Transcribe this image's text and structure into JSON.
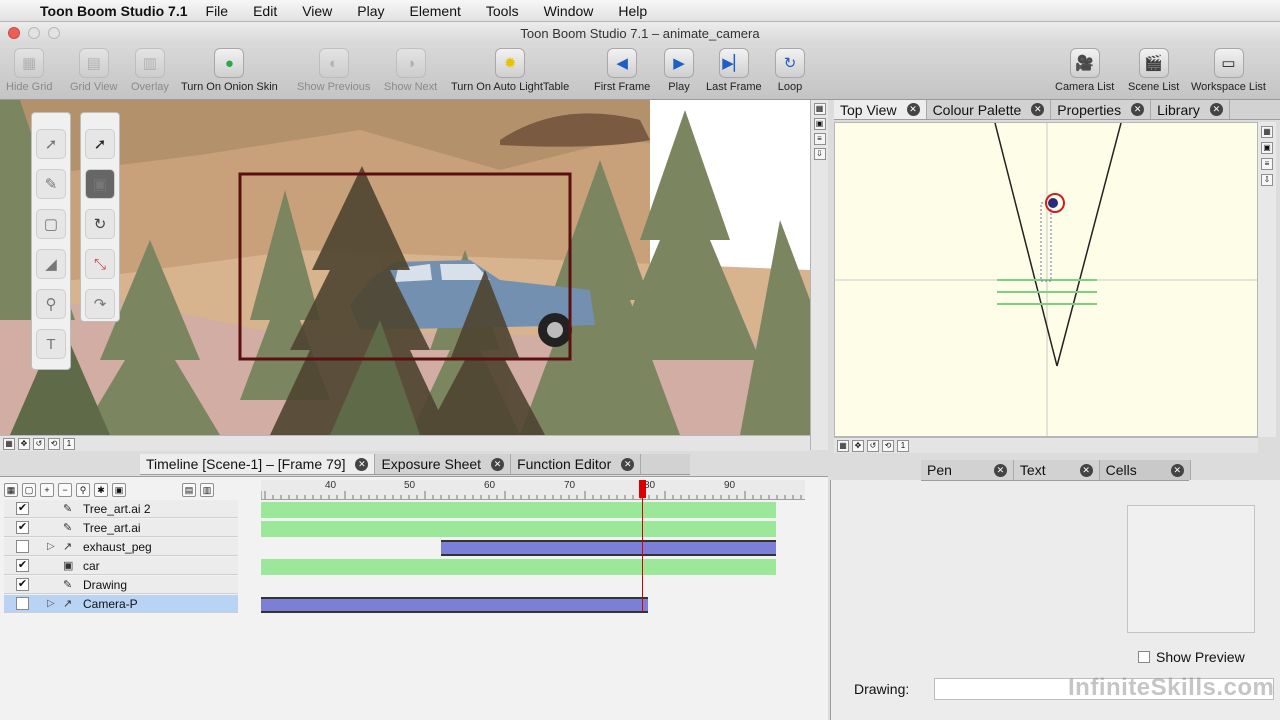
{
  "menubar": {
    "app_name": "Toon Boom Studio 7.1",
    "items": [
      "File",
      "Edit",
      "View",
      "Play",
      "Element",
      "Tools",
      "Window",
      "Help"
    ]
  },
  "window": {
    "title": "Toon Boom Studio 7.1 – animate_camera"
  },
  "toolbar": {
    "left": [
      {
        "label": "Hide Grid",
        "icon": "grid-icon",
        "enabled": false
      },
      {
        "label": "Grid View",
        "icon": "grid-view-icon",
        "enabled": false
      },
      {
        "label": "Overlay",
        "icon": "overlay-icon",
        "enabled": false
      },
      {
        "label": "Turn On Onion Skin",
        "icon": "onion-skin-icon",
        "enabled": true
      },
      {
        "label": "Show Previous",
        "icon": "previous-icon",
        "enabled": false
      },
      {
        "label": "Show Next",
        "icon": "next-icon",
        "enabled": false
      },
      {
        "label": "Turn On Auto LightTable",
        "icon": "lightbulb-icon",
        "enabled": true
      },
      {
        "label": "First Frame",
        "icon": "first-frame-icon",
        "enabled": true
      },
      {
        "label": "Play",
        "icon": "play-icon",
        "enabled": true
      },
      {
        "label": "Last Frame",
        "icon": "last-frame-icon",
        "enabled": true
      },
      {
        "label": "Loop",
        "icon": "loop-icon",
        "enabled": true
      }
    ],
    "right": [
      {
        "label": "Camera List",
        "icon": "camera-icon"
      },
      {
        "label": "Scene List",
        "icon": "clapper-icon"
      },
      {
        "label": "Workspace List",
        "icon": "workspace-icon"
      }
    ]
  },
  "right_tabs": [
    {
      "label": "Top View",
      "active": true
    },
    {
      "label": "Colour Palette",
      "active": false
    },
    {
      "label": "Properties",
      "active": false
    },
    {
      "label": "Library",
      "active": false
    }
  ],
  "timeline_tabs": [
    {
      "label": "Timeline [Scene-1] – [Frame 79]",
      "active": true
    },
    {
      "label": "Exposure Sheet",
      "active": false
    },
    {
      "label": "Function Editor",
      "active": false
    }
  ],
  "ruler_ticks": [
    "40",
    "50",
    "60",
    "70",
    "80",
    "90"
  ],
  "layers": [
    {
      "name": "Tree_art.ai 2",
      "checked": true,
      "expandable": false,
      "type": "drawing",
      "selected": false
    },
    {
      "name": "Tree_art.ai",
      "checked": true,
      "expandable": false,
      "type": "drawing",
      "selected": false
    },
    {
      "name": "exhaust_peg",
      "checked": false,
      "expandable": true,
      "type": "peg",
      "selected": false
    },
    {
      "name": "car",
      "checked": true,
      "expandable": false,
      "type": "image",
      "selected": false
    },
    {
      "name": "Drawing",
      "checked": true,
      "expandable": false,
      "type": "drawing",
      "selected": false
    },
    {
      "name": "Camera-P",
      "checked": false,
      "expandable": true,
      "type": "peg",
      "selected": true
    }
  ],
  "bottom_tabs": [
    {
      "label": "Pen",
      "active": false
    },
    {
      "label": "Text",
      "active": false
    },
    {
      "label": "Cells",
      "active": true
    }
  ],
  "cells_panel": {
    "show_preview_label": "Show Preview",
    "drawing_label": "Drawing:",
    "drawing_value": ""
  },
  "watermark": "InfiniteSkills.com",
  "colors": {
    "frame_green": "#9be89b",
    "peg_purple": "#7b7fd6",
    "playhead": "#d00000",
    "selection_blue": "#b9d3f5"
  }
}
